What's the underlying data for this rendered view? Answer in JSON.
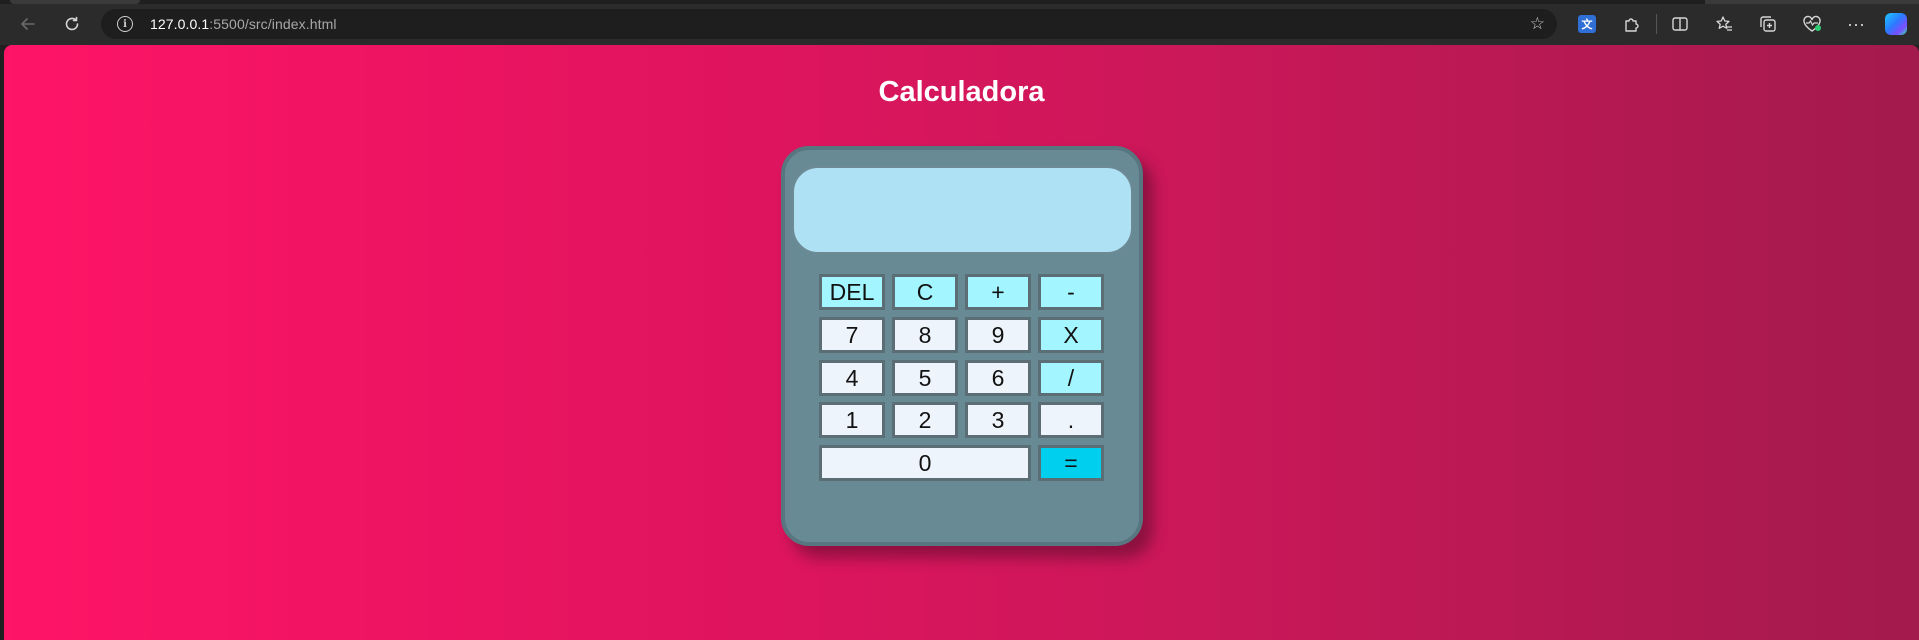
{
  "browser": {
    "url_host": "127.0.0.1",
    "url_path": ":5500/src/index.html"
  },
  "page": {
    "title": "Calculadora",
    "background_colors": [
      "#ff1466",
      "#a31a4c"
    ]
  },
  "calculator": {
    "display_value": "",
    "colors": {
      "body": "#688a95",
      "display": "#aee1f4",
      "number_key": "#eef4fb",
      "operator_key": "#a3f5ff",
      "equals_key": "#00cfee"
    },
    "keys": {
      "del": "DEL",
      "clear": "C",
      "plus": "+",
      "minus": "-",
      "seven": "7",
      "eight": "8",
      "nine": "9",
      "multiply": "X",
      "four": "4",
      "five": "5",
      "six": "6",
      "divide": "/",
      "one": "1",
      "two": "2",
      "three": "3",
      "dot": ".",
      "zero": "0",
      "equals": "="
    }
  }
}
